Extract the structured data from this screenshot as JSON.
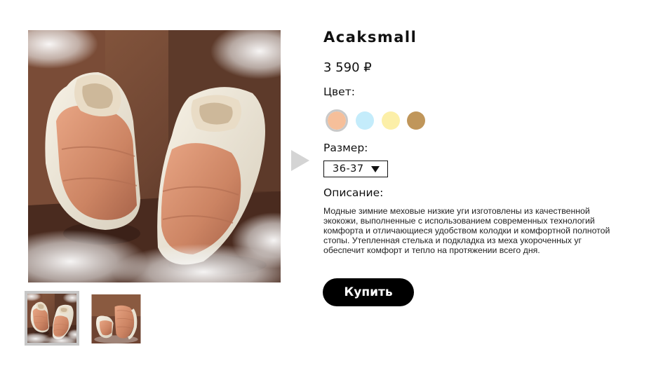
{
  "product": {
    "title": "Acaksmall",
    "price": "3 590 ₽"
  },
  "color": {
    "label": "Цвет:",
    "swatches": [
      {
        "name": "peach",
        "hex": "#f6bf9a",
        "selected": true
      },
      {
        "name": "light-blue",
        "hex": "#c4ecfb",
        "selected": false
      },
      {
        "name": "light-yellow",
        "hex": "#fcefa8",
        "selected": false
      },
      {
        "name": "gold-brown",
        "hex": "#c0965a",
        "selected": false
      }
    ]
  },
  "size": {
    "label": "Размер:",
    "selected": "36-37"
  },
  "description": {
    "label": "Описание:",
    "text": "Модные зимние меховые низкие уги изготовлены из качественной экокожи, выполненные с использованием современных технологий комфорта и отличающиеся удобством колодки и комфортной полнотой стопы. Утепленная стелька и подкладка из меха укороченных уг обеспечит комфорт и тепло на протяжении всего дня."
  },
  "buy_button": {
    "label": "Купить"
  },
  "gallery": {
    "images": [
      "slippers-main",
      "slippers-side"
    ],
    "active_index": 0
  },
  "colors": {
    "background_brown": "#6b4533",
    "slipper_orange": "#d18a68",
    "slipper_cream": "#ece6d8",
    "arrow_gray": "#d4d4d4"
  }
}
